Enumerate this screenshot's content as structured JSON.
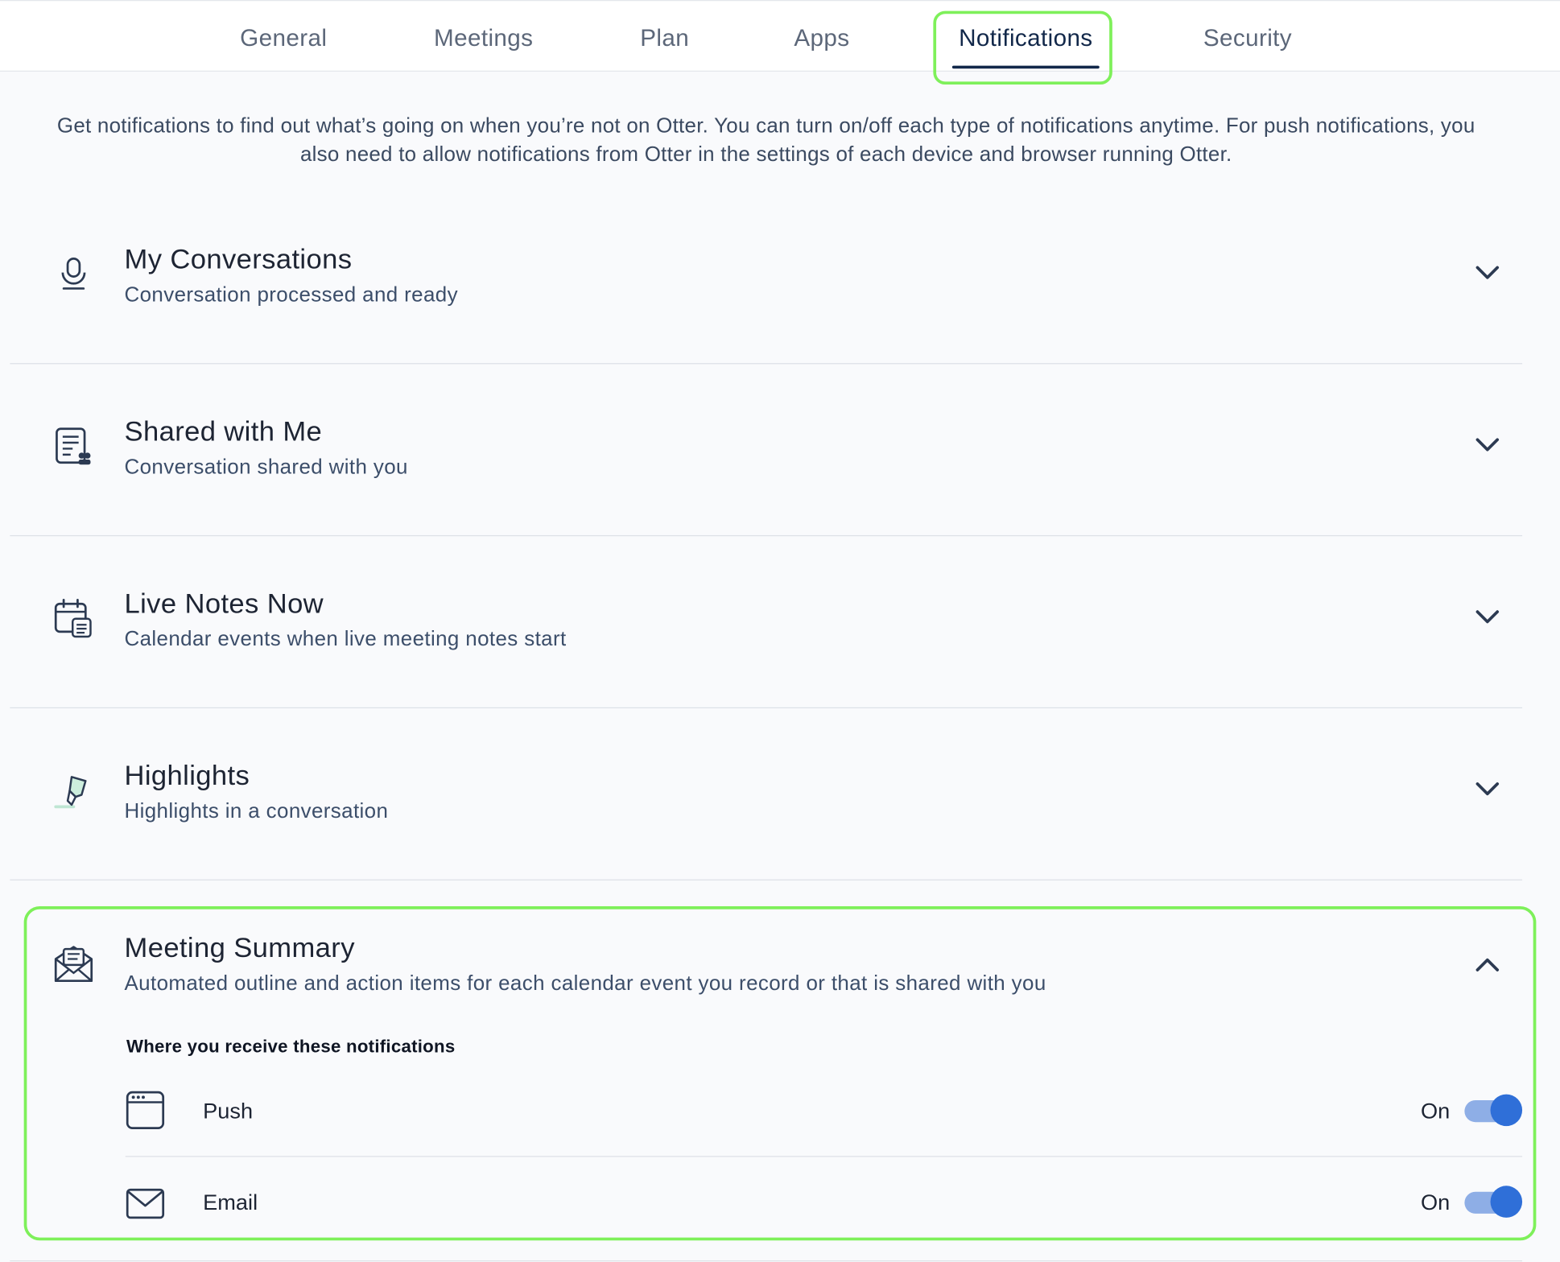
{
  "tabs": [
    {
      "label": "General"
    },
    {
      "label": "Meetings"
    },
    {
      "label": "Plan"
    },
    {
      "label": "Apps"
    },
    {
      "label": "Notifications"
    },
    {
      "label": "Security"
    }
  ],
  "active_tab": "Notifications",
  "intro_text": "Get notifications to find out what’s going on when you’re not on Otter. You can turn on/off each type of notifications anytime. For push notifications, you also need to allow notifications from Otter in the settings of each device and browser running Otter.",
  "sections": [
    {
      "title": "My Conversations",
      "subtitle": "Conversation processed and ready",
      "icon": "microphone-icon",
      "expanded": false
    },
    {
      "title": "Shared with Me",
      "subtitle": "Conversation shared with you",
      "icon": "shared-document-icon",
      "expanded": false
    },
    {
      "title": "Live Notes Now",
      "subtitle": "Calendar events when live meeting notes start",
      "icon": "calendar-notes-icon",
      "expanded": false
    },
    {
      "title": "Highlights",
      "subtitle": "Highlights in a conversation",
      "icon": "highlighter-icon",
      "expanded": false
    },
    {
      "title": "Meeting Summary",
      "subtitle": "Automated outline and action items for each calendar event you record or that is shared with you",
      "icon": "envelope-open-icon",
      "expanded": true
    }
  ],
  "meeting_summary": {
    "where_label": "Where you receive these notifications",
    "channels": [
      {
        "label": "Push",
        "state": "On",
        "icon": "browser-window-icon",
        "enabled": true
      },
      {
        "label": "Email",
        "state": "On",
        "icon": "mail-icon",
        "enabled": true
      }
    ]
  },
  "colors": {
    "accent": "#2f6fd8",
    "highlight": "#7ef05a",
    "active_tab": "#12284a"
  }
}
